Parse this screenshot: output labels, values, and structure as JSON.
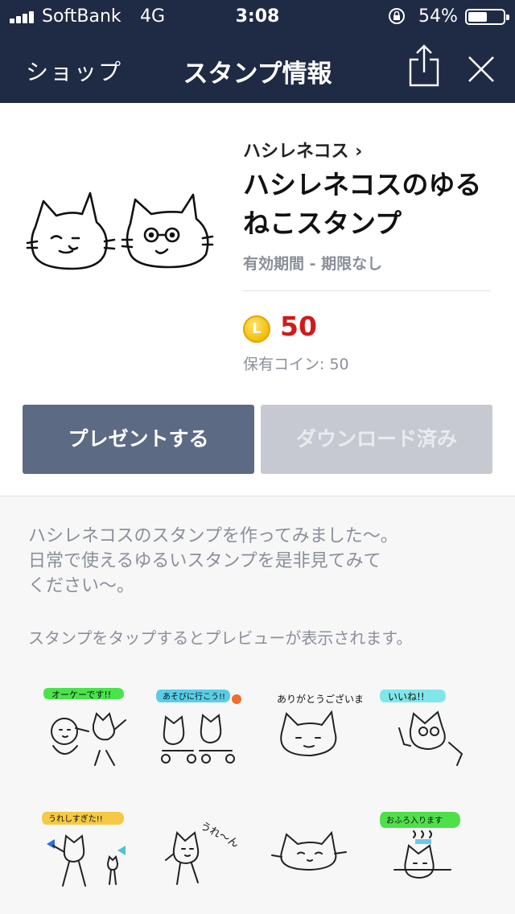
{
  "status_bar": {
    "carrier": "SoftBank",
    "network": "4G",
    "time": "3:08",
    "battery_percent": "54%",
    "battery_level": 0.54
  },
  "nav": {
    "back_label": "ショップ",
    "title": "スタンプ情報",
    "share_icon": "share-icon",
    "close_icon": "close-icon"
  },
  "pack": {
    "creator_label": "ハシレネコス ›",
    "title": "ハシレネコスのゆるねこスタンプ",
    "period": "有効期間 - 期限なし",
    "coin_letter": "L",
    "price": "50",
    "owned_coins": "保有コイン: 50"
  },
  "buttons": {
    "present": "プレゼントする",
    "download": "ダウンロード済み"
  },
  "description": {
    "lines": [
      "ハシレネコスのスタンプを作ってみました〜。",
      "日常で使えるゆるいスタンプを是非見てみて",
      "ください〜。"
    ],
    "hint": "スタンプをタップするとプレビューが表示されます。"
  },
  "stickers": [
    {
      "caption": "オーケーです!!",
      "bubble_color": "#49e34a"
    },
    {
      "caption": "あそびに行こう!!",
      "bubble_color": "#58cde8"
    },
    {
      "caption": "ありがとうございます!!",
      "bubble_color": ""
    },
    {
      "caption": "いいね!!",
      "bubble_color": "#7fe7e9"
    },
    {
      "caption": "うれしすぎた!!",
      "bubble_color": "#f6c945"
    },
    {
      "caption": "うれ〜ん",
      "bubble_color": ""
    },
    {
      "caption": "",
      "bubble_color": ""
    },
    {
      "caption": "おふろ入ります",
      "bubble_color": "#4ee04a"
    }
  ],
  "colors": {
    "navbar": "#1f2a44",
    "price": "#d11a1a",
    "present_button": "#5d6a84",
    "download_button": "#c6c9d1"
  }
}
